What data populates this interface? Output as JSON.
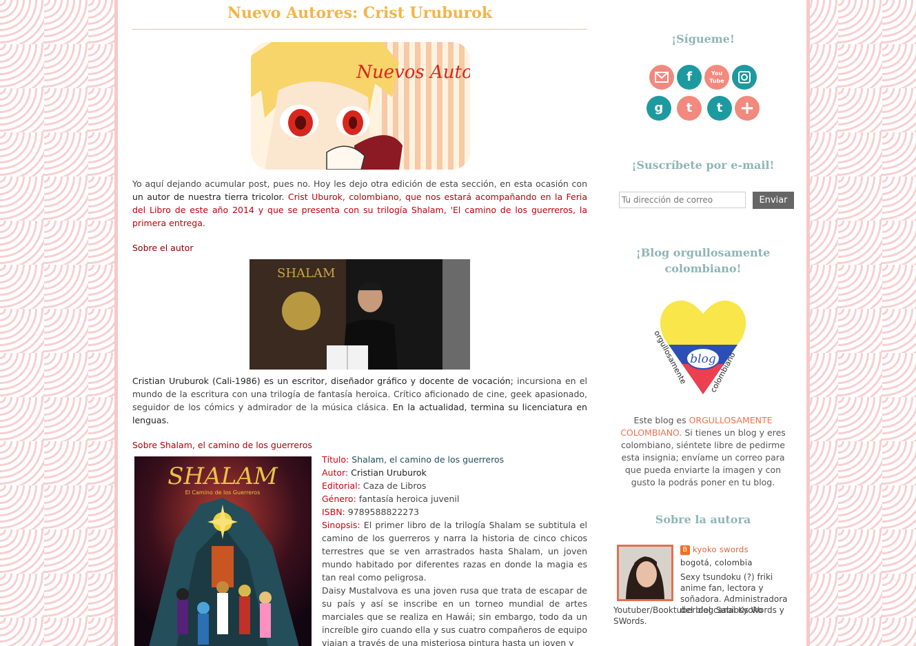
{
  "post": {
    "title": "Nuevo Autores: Crist Uruburok",
    "banner_text": "Nuevos Autores",
    "intro_a": "Yo aquí dejando acumular post, pues no. Hoy les dejo otra edición de esta sección, en esta ocasión con ",
    "intro_b": "un autor de nuestra tierra tricolor.",
    "intro_c": " Crist Uburok, colombiano, que nos estará acompañando en la Feria del Libro de este año 2014 y que se presenta con su trilogía Shalam, 'El camino de los guerreros, la primera entrega.",
    "about_author_heading": "Sobre el autor",
    "bio_a": "Cristian Uruburok (Cali-1986) es un escritor, diseñador gráfico y docente de vocación;",
    "bio_b": " incursiona en el mundo de la escritura con una trilogía de fantasía heroica. Crítico aficionado de cine, geek apasionado, seguidor de los cómics y admirador de la música clásica.",
    "bio_c": " En la actualidad, termina su licenciatura en lenguas.",
    "shalam_heading": "Sobre Shalam, el camino de los guerreros",
    "cover_title": "SHALAM",
    "cover_subtitle": "El Camino de los Guerreros",
    "photo_poster_title": "SHALAM",
    "details": {
      "titulo_label": "Título:",
      "titulo_value": "Shalam, el camino de los guerreros",
      "autor_label": "Autor:",
      "autor_value": "Cristian Uruburok",
      "editorial_label": "Editorial:",
      "editorial_value": "Caza de Libros",
      "genero_label": "Género:",
      "genero_value": "fantasía heroica juvenil",
      "isbn_label": "ISBN:",
      "isbn_value": "9789588822273",
      "sinopsis_label": "Sinopsis:",
      "sinopsis_value": "El primer libro de la trilogía Shalam se subtitula el camino de los guerreros y narra la historia de cinco chicos terrestres que se ven arrastrados hasta Shalam, un joven mundo habitado por diferentes razas en donde la magia es tan real como peligrosa.",
      "sinopsis_2": "Daisy Mustalvova es una joven rusa que trata de escapar de su país y así se inscribe en un torneo mundial de artes marciales que se realiza en Hawái; sin embargo, todo da un increíble giro cuando ella y sus cuatro compañeros de equipo viajan a través de una misteriosa pintura hasta un joven y"
    }
  },
  "sidebar": {
    "follow_title": "¡Sígueme!",
    "social_icons": [
      "email-icon",
      "facebook-icon",
      "youtube-icon",
      "instagram-icon",
      "goodreads-icon",
      "twitter-icon",
      "tumblr-icon",
      "google-plus-icon"
    ],
    "youtube_text": "You Tube",
    "subscribe_title": "¡Suscríbete por e-mail!",
    "email_placeholder": "Tu dirección de correo",
    "email_button": "Enviar",
    "badge_title": "¡Blog orgullosamente colombiano!",
    "badge_word": "blog",
    "badge_arc_left": "orgullosamente",
    "badge_arc_right": "colombiano",
    "badge_text_a": "Este blog es ",
    "badge_text_b": "ORGULLOSAMENTE COLOMBIANO.",
    "badge_text_c": " Si tienes un blog y eres colombiano, siéntete libre de pedirme esta insignia; envíame un correo para que pueda enviarte la imagen y con gusto la podrás poner en tu blog.",
    "about_title": "Sobre la autora",
    "author_name": "kyoko swords",
    "author_location": "bogotá, colombia",
    "author_bio_a": "Sexy tsundoku (?) friki anime fan, lectora y soñadora. Administradora del blog Sabious Words y",
    "author_bio_b": "Youtuber/Booktuber del canal Kyoko SWords."
  },
  "colors": {
    "title": "#f3b547",
    "teal": "#1c9aa0",
    "coral": "#f2897e",
    "sidebar_title": "#8fb5b6",
    "red_text": "#c0000b"
  }
}
